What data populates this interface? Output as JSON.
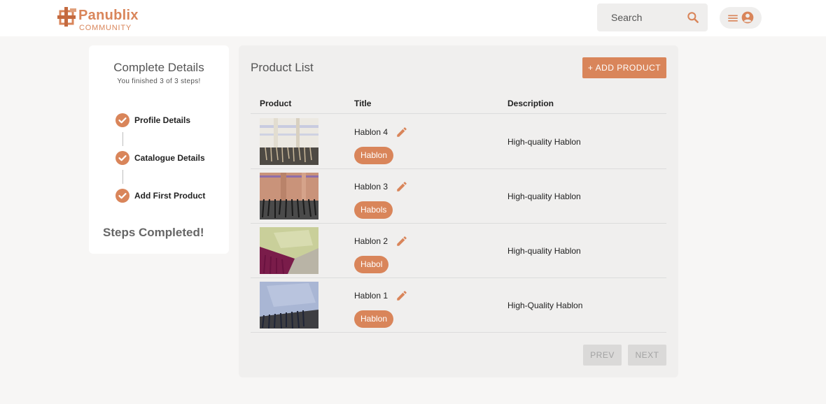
{
  "brand": {
    "name": "Panublix",
    "tagline": "COMMUNITY",
    "accent_color": "#d9855a"
  },
  "header": {
    "search_placeholder": "Search",
    "search_icon": "search-icon",
    "menu_icon": "menu-icon",
    "account_icon": "account-circle-icon"
  },
  "steps": {
    "title": "Complete Details",
    "subtitle": "You finished 3 of 3 steps!",
    "items": [
      {
        "label": "Profile Details",
        "done": true
      },
      {
        "label": "Catalogue Details",
        "done": true
      },
      {
        "label": "Add First Product",
        "done": true
      }
    ],
    "completed_label": "Steps Completed!"
  },
  "products": {
    "title": "Product List",
    "add_button": "+ ADD PRODUCT",
    "columns": [
      "Product",
      "Title",
      "Description"
    ],
    "rows": [
      {
        "title": "Hablon 4",
        "tag": "Hablon",
        "description": "High-quality Hablon"
      },
      {
        "title": "Hablon 3",
        "tag": "Habols",
        "description": "High-quality Hablon"
      },
      {
        "title": "Hablon 2",
        "tag": "Habol",
        "description": "High-quality Hablon"
      },
      {
        "title": "Hablon 1",
        "tag": "Hablon",
        "description": "High-Quality Hablon"
      }
    ],
    "prev_button": "PREV",
    "next_button": "NEXT"
  }
}
